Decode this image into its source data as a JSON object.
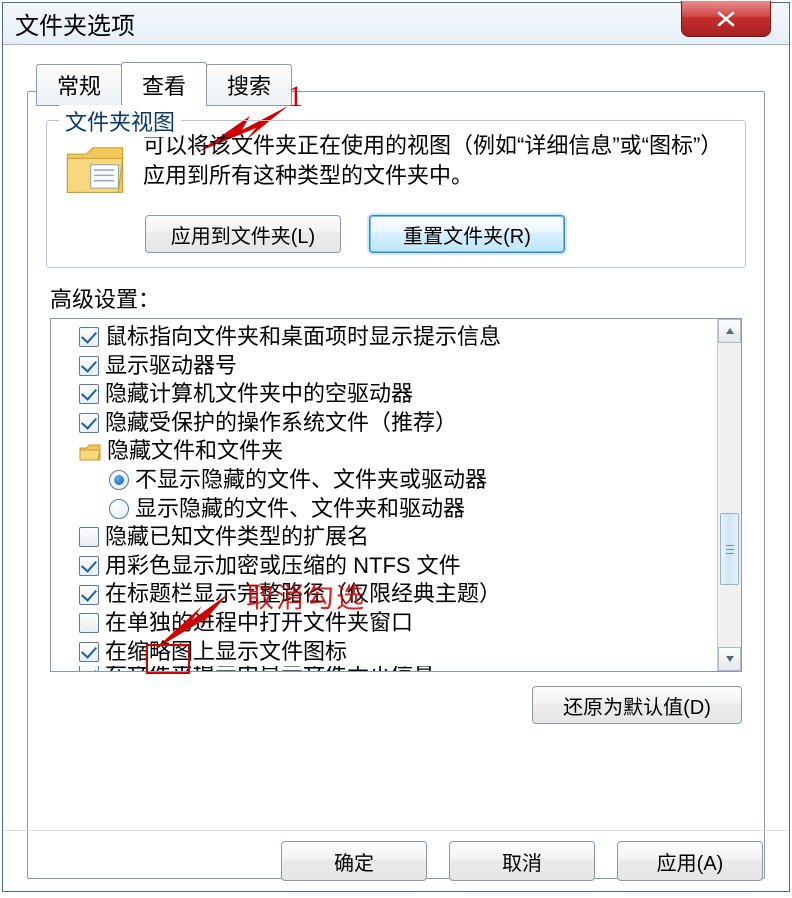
{
  "window": {
    "title": "文件夹选项",
    "close_tooltip": "关闭"
  },
  "tabs": {
    "general": "常规",
    "view": "查看",
    "search": "搜索"
  },
  "folderview": {
    "legend": "文件夹视图",
    "desc": "可以将该文件夹正在使用的视图（例如“详细信息”或“图标”）应用到所有这种类型的文件夹中。",
    "apply_btn": "应用到文件夹(L)",
    "reset_btn": "重置文件夹(R)"
  },
  "advanced": {
    "label": "高级设置：",
    "items": [
      {
        "kind": "check",
        "checked": true,
        "text": "鼠标指向文件夹和桌面项时显示提示信息"
      },
      {
        "kind": "check",
        "checked": true,
        "text": "显示驱动器号"
      },
      {
        "kind": "check",
        "checked": true,
        "text": "隐藏计算机文件夹中的空驱动器"
      },
      {
        "kind": "check",
        "checked": true,
        "text": "隐藏受保护的操作系统文件（推荐）"
      },
      {
        "kind": "folder",
        "text": "隐藏文件和文件夹"
      },
      {
        "kind": "radio",
        "checked": true,
        "indent": 2,
        "text": "不显示隐藏的文件、文件夹或驱动器"
      },
      {
        "kind": "radio",
        "checked": false,
        "indent": 2,
        "text": "显示隐藏的文件、文件夹和驱动器"
      },
      {
        "kind": "check",
        "checked": false,
        "text": "隐藏已知文件类型的扩展名"
      },
      {
        "kind": "check",
        "checked": true,
        "text": "用彩色显示加密或压缩的 NTFS 文件"
      },
      {
        "kind": "check",
        "checked": true,
        "text": "在标题栏显示完整路径（仅限经典主题）"
      },
      {
        "kind": "check",
        "checked": false,
        "text": "在单独的进程中打开文件夹窗口"
      },
      {
        "kind": "check",
        "checked": true,
        "text": "在缩略图上显示文件图标"
      },
      {
        "kind": "check",
        "checked": true,
        "text": "在文件夹提示中显示文件大小信息"
      }
    ],
    "restore_btn": "还原为默认值(D)"
  },
  "dialog_buttons": {
    "ok": "确定",
    "cancel": "取消",
    "apply": "应用(A)"
  },
  "annotations": {
    "num1": "1",
    "text2": "取消勾选"
  }
}
